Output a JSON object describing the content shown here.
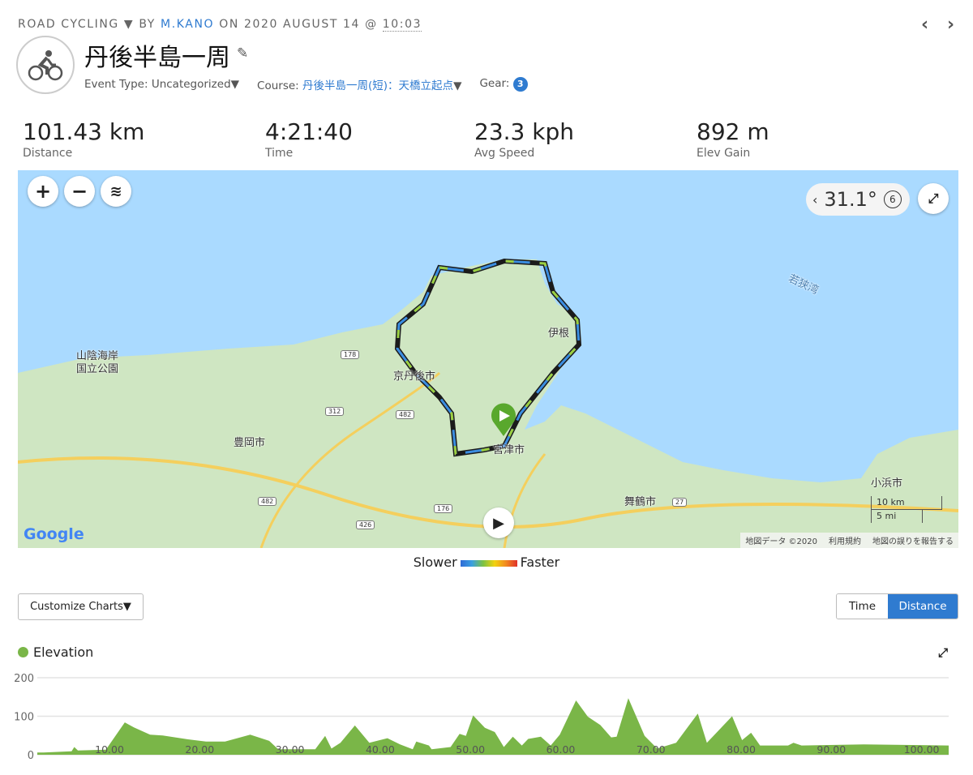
{
  "header": {
    "activity_type": "ROAD CYCLING",
    "by": "BY",
    "user": "M.KANO",
    "on": "ON 2020 AUGUST 14 @",
    "time": "10:03",
    "title": "丹後半島一周",
    "event_type": "Event Type: Uncategorized",
    "course_label": "Course:",
    "course": "丹後半島一周(短)：天橋立起点",
    "gear_label": "Gear:",
    "gear_count": "3"
  },
  "stats": [
    {
      "value": "101.43 km",
      "label": "Distance"
    },
    {
      "value": "4:21:40",
      "label": "Time"
    },
    {
      "value": "23.3 kph",
      "label": "Avg Speed"
    },
    {
      "value": "892 m",
      "label": "Elev Gain"
    }
  ],
  "map": {
    "heading": "31.1°",
    "rotate_count": "6",
    "labels": [
      "山陰海岸",
      "国立公園",
      "豊岡市",
      "京丹後市",
      "宮津市",
      "舞鶴市",
      "小浜市",
      "伊根",
      "若狭湾"
    ],
    "routes": [
      "178",
      "312",
      "482",
      "482",
      "176",
      "426",
      "27"
    ],
    "scale_km": "10 km",
    "scale_mi": "5 mi",
    "logo": "Google",
    "attribution": [
      "地図データ ©2020",
      "利用規約",
      "地図の誤りを報告する"
    ]
  },
  "legend": {
    "slower": "Slower",
    "faster": "Faster"
  },
  "controls": {
    "customize": "Customize Charts▼",
    "time": "Time",
    "distance": "Distance"
  },
  "chart_data": {
    "type": "area",
    "title": "Elevation",
    "color": "#7ab648",
    "xlim": [
      2,
      103
    ],
    "ylim": [
      0,
      200
    ],
    "yticks": [
      0,
      100,
      200
    ],
    "xticks": [
      "10.00",
      "20.00",
      "30.00",
      "40.00",
      "50.00",
      "60.00",
      "70.00",
      "80.00",
      "90.00",
      "100.00"
    ],
    "grid": true,
    "x": [
      2,
      2.7,
      5.8,
      6.1,
      6.5,
      9.6,
      11.7,
      12.7,
      14.5,
      15.9,
      18.7,
      20.7,
      22.8,
      25.6,
      27.7,
      28.7,
      32.8,
      33.9,
      34.6,
      35.6,
      37.2,
      38.8,
      40.8,
      42.2,
      43.6,
      44.0,
      45.4,
      45.7,
      47.8,
      48.8,
      49.5,
      50.3,
      51.6,
      52.7,
      53.7,
      54.7,
      55.7,
      56.4,
      57.8,
      58.9,
      59.9,
      61.7,
      63.0,
      64.4,
      65.6,
      66.2,
      67.5,
      69.3,
      70.7,
      72.8,
      75.2,
      76.2,
      79.0,
      80.1,
      81.1,
      82.1,
      85.2,
      85.8,
      86.7,
      93.6,
      103
    ],
    "y": [
      6,
      6,
      9,
      20,
      11,
      13,
      84,
      71,
      52,
      50,
      40,
      34,
      34,
      52,
      36,
      14,
      14,
      49,
      16,
      31,
      76,
      31,
      43,
      27,
      14,
      34,
      24,
      14,
      20,
      54,
      49,
      102,
      70,
      59,
      20,
      47,
      24,
      41,
      47,
      24,
      52,
      141,
      99,
      77,
      45,
      47,
      147,
      49,
      16,
      31,
      107,
      31,
      100,
      38,
      57,
      24,
      24,
      31,
      24,
      27,
      24
    ]
  }
}
